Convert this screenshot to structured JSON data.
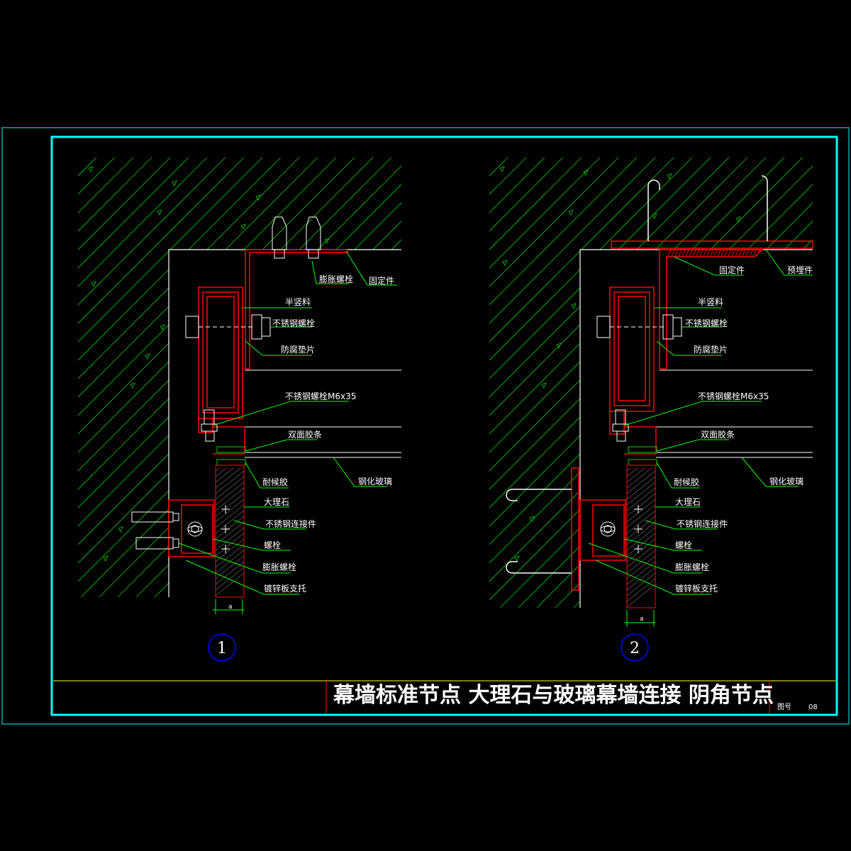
{
  "colors": {
    "background": "#000000",
    "frame": "#00ffff",
    "hatch": "#00cc00",
    "outline": "#ffffff",
    "member": "#ff0000",
    "leader": "#00ff00",
    "callout": "#0000ff",
    "titleline": "#ffff00"
  },
  "detail1": {
    "number": "1",
    "labels": {
      "expansion_bolt_top": "膨胀螺栓",
      "fixing_piece": "固定件",
      "half_frame": "半竖料",
      "ss_bolt": "不锈钢螺栓",
      "anticorrosion_pad": "防腐垫片",
      "ss_bolt_m6": "不锈钢螺栓M6x35",
      "double_tape": "双面胶条",
      "weather_sealant": "耐候胶",
      "tempered_glass": "钢化玻璃",
      "marble": "大理石",
      "ss_connector": "不锈钢连接件",
      "bolt": "螺栓",
      "expansion_bolt": "膨胀螺栓",
      "galv_bracket": "镀锌板支托"
    },
    "dim": "a"
  },
  "detail2": {
    "number": "2",
    "labels": {
      "fixing_piece": "固定件",
      "embedded_part": "预埋件",
      "half_frame": "半竖料",
      "ss_bolt": "不锈钢螺栓",
      "anticorrosion_pad": "防腐垫片",
      "ss_bolt_m6": "不锈钢螺栓M6x35",
      "double_tape": "双面胶条",
      "weather_sealant": "耐候胶",
      "tempered_glass": "钢化玻璃",
      "marble": "大理石",
      "ss_connector": "不锈钢连接件",
      "bolt": "螺栓",
      "expansion_bolt": "膨胀螺栓",
      "galv_bracket": "镀锌板支托"
    },
    "dim": "a"
  },
  "title_block": {
    "title": "幕墙标准节点 大理石与玻璃幕墙连接   阴角节点",
    "sheet_label": "图号",
    "sheet_number": "08"
  }
}
